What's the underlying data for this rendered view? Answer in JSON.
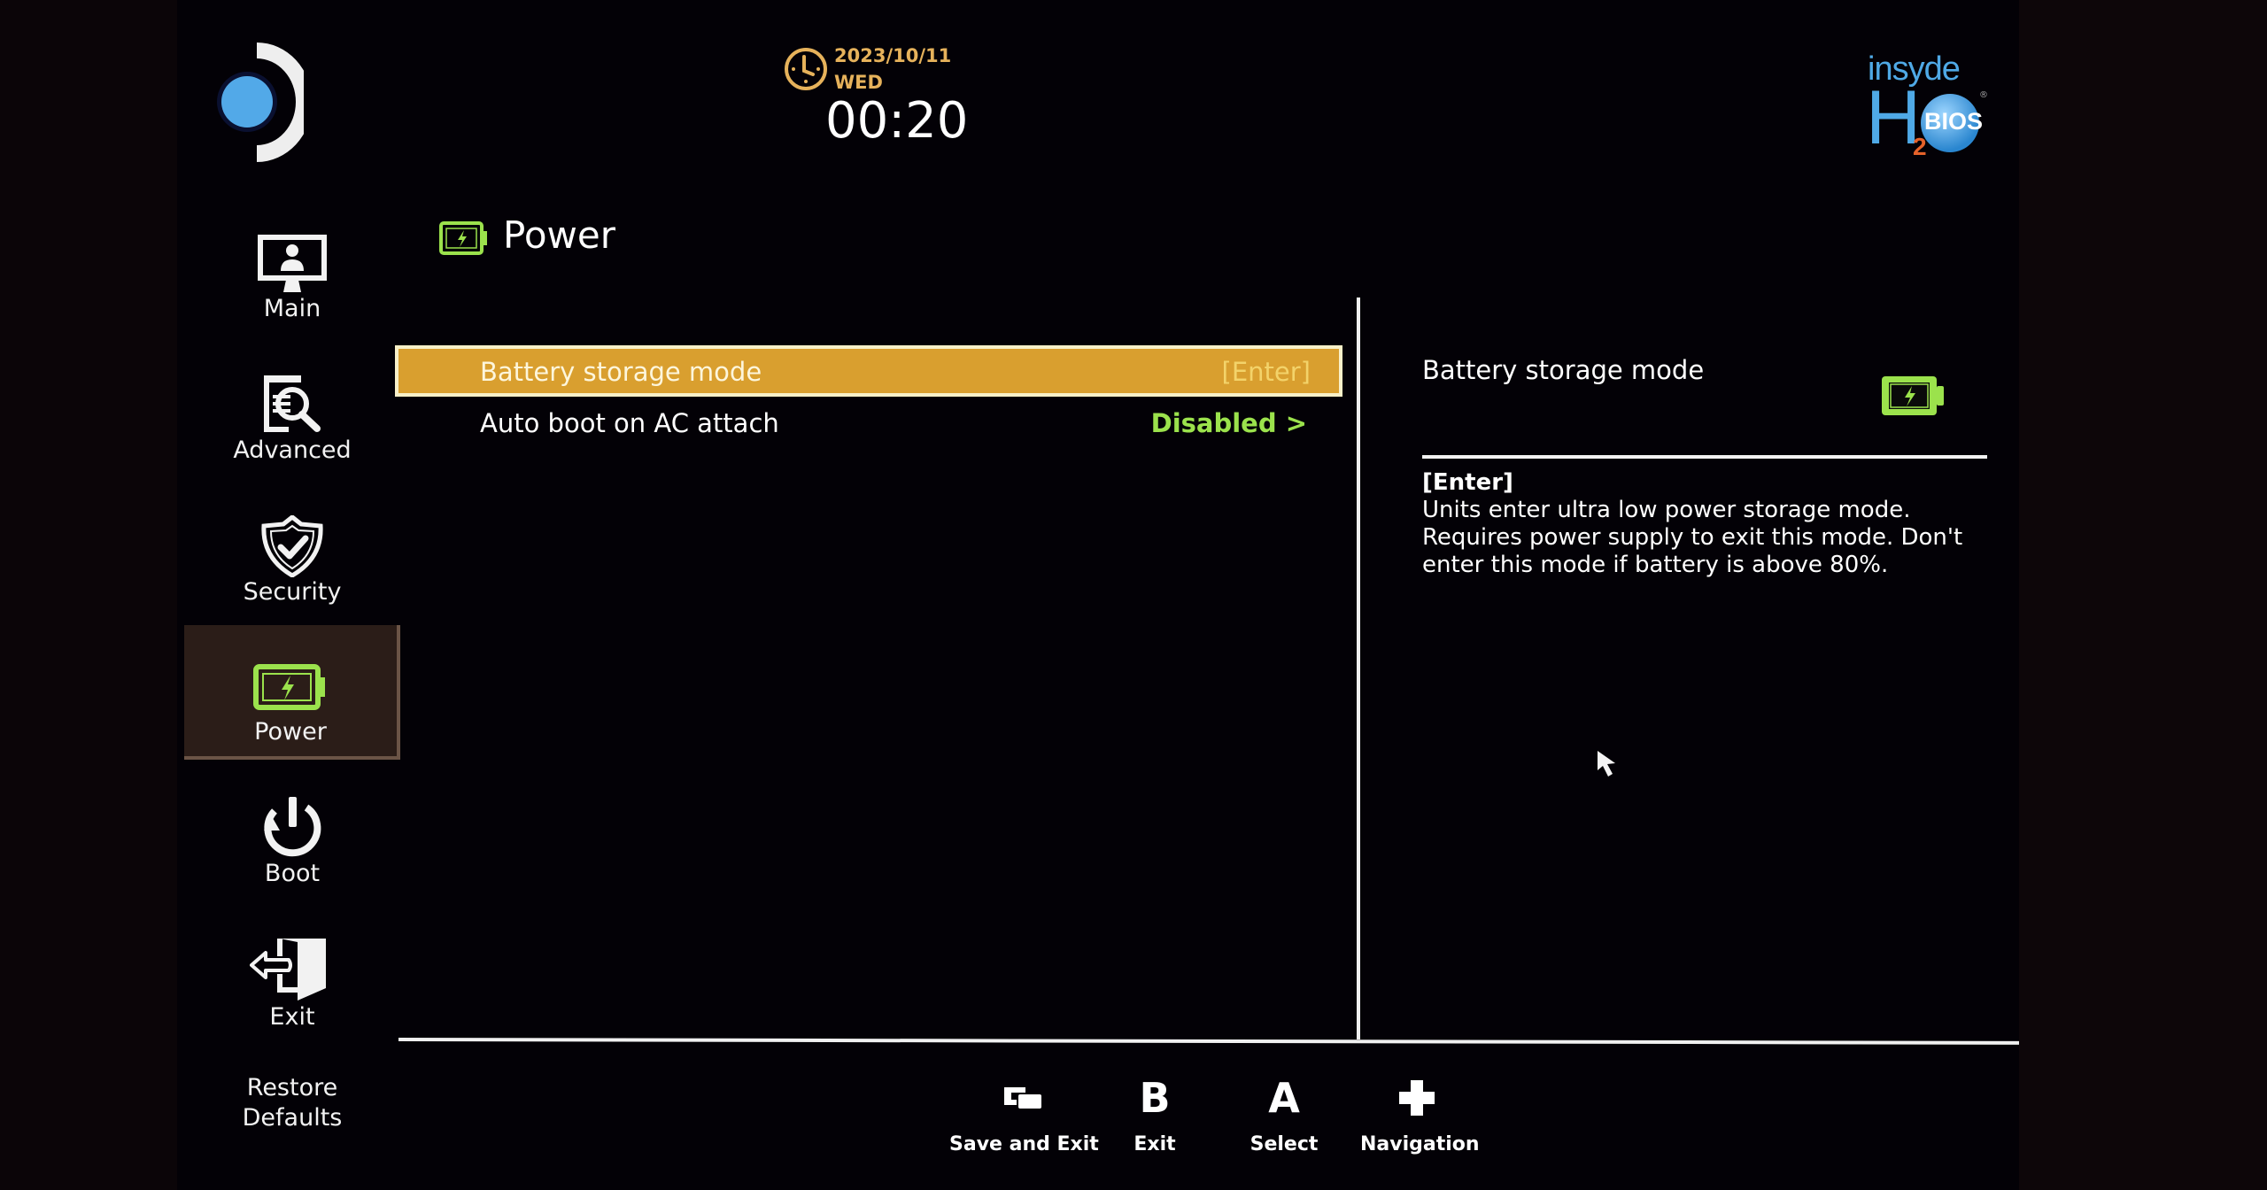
{
  "header": {
    "date": "2023/10/11",
    "weekday": "WED",
    "time": "00:20",
    "vendor_logo": {
      "word": "insyde",
      "letter": "H",
      "subscript": "2",
      "badge": "BIOS",
      "reg": "®"
    }
  },
  "sidebar": {
    "items": [
      {
        "label": "Main",
        "icon": "monitor-user-icon",
        "active": false
      },
      {
        "label": "Advanced",
        "icon": "document-search-icon",
        "active": false
      },
      {
        "label": "Security",
        "icon": "shield-check-icon",
        "active": false
      },
      {
        "label": "Power",
        "icon": "battery-charging-icon",
        "active": true
      },
      {
        "label": "Boot",
        "icon": "power-restart-icon",
        "active": false
      },
      {
        "label": "Exit",
        "icon": "door-exit-icon",
        "active": false
      }
    ],
    "restore_defaults": [
      "Restore",
      "Defaults"
    ]
  },
  "page": {
    "title": "Power",
    "title_icon": "battery-charging-icon"
  },
  "settings": [
    {
      "label": "Battery storage mode",
      "value": "[Enter]",
      "selected": true
    },
    {
      "label": "Auto boot on AC attach",
      "value": "Disabled >",
      "selected": false
    }
  ],
  "help": {
    "title": "Battery storage mode",
    "icon": "battery-charging-icon",
    "lines": [
      "[Enter]",
      "Units enter ultra low power storage mode.",
      "Requires power supply to exit this mode. Don't",
      "enter this mode if battery is above 80%."
    ]
  },
  "footer_hints": [
    {
      "key": "▭",
      "icon": "menu-button-icon",
      "label": "Save and Exit"
    },
    {
      "key": "B",
      "icon": "b-button-icon",
      "label": "Exit"
    },
    {
      "key": "A",
      "icon": "a-button-icon",
      "label": "Select"
    },
    {
      "key": "✚",
      "icon": "dpad-icon",
      "label": "Navigation"
    }
  ],
  "colors": {
    "accent_gold": "#d99f2f",
    "date_gold": "#e6b25b",
    "battery_green": "#9be24c",
    "logo_blue": "#4fa9e6"
  }
}
